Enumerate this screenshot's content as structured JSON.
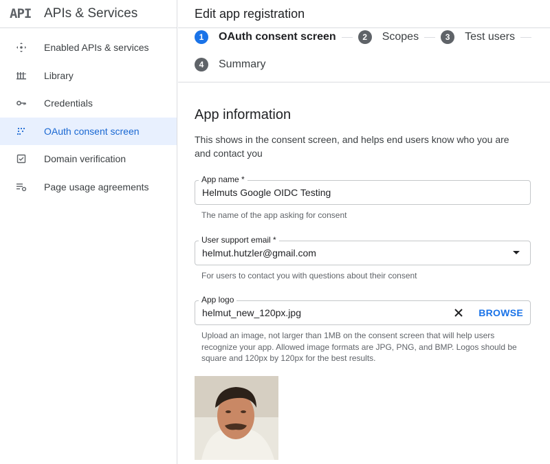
{
  "sidebar": {
    "logo": "API",
    "title": "APIs & Services",
    "items": [
      {
        "label": "Enabled APIs & services"
      },
      {
        "label": "Library"
      },
      {
        "label": "Credentials"
      },
      {
        "label": "OAuth consent screen"
      },
      {
        "label": "Domain verification"
      },
      {
        "label": "Page usage agreements"
      }
    ]
  },
  "header": {
    "title": "Edit app registration"
  },
  "stepper": {
    "steps": [
      {
        "number": "1",
        "label": "OAuth consent screen"
      },
      {
        "number": "2",
        "label": "Scopes"
      },
      {
        "number": "3",
        "label": "Test users"
      },
      {
        "number": "4",
        "label": "Summary"
      }
    ]
  },
  "app_info": {
    "title": "App information",
    "description": "This shows in the consent screen, and helps end users know who you are and contact you",
    "app_name": {
      "label": "App name *",
      "value": "Helmuts Google OIDC Testing",
      "hint": "The name of the app asking for consent"
    },
    "support_email": {
      "label": "User support email *",
      "value": "helmut.hutzler@gmail.com",
      "hint": "For users to contact you with questions about their consent"
    },
    "app_logo": {
      "label": "App logo",
      "value": "helmut_new_120px.jpg",
      "browse_label": "BROWSE",
      "hint": "Upload an image, not larger than 1MB on the consent screen that will help users recognize your app. Allowed image formats are JPG, PNG, and BMP. Logos should be square and 120px by 120px for the best results."
    }
  },
  "colors": {
    "accent": "#1a73e8",
    "active_bg": "#e8f0fe",
    "border": "#dadce0"
  }
}
